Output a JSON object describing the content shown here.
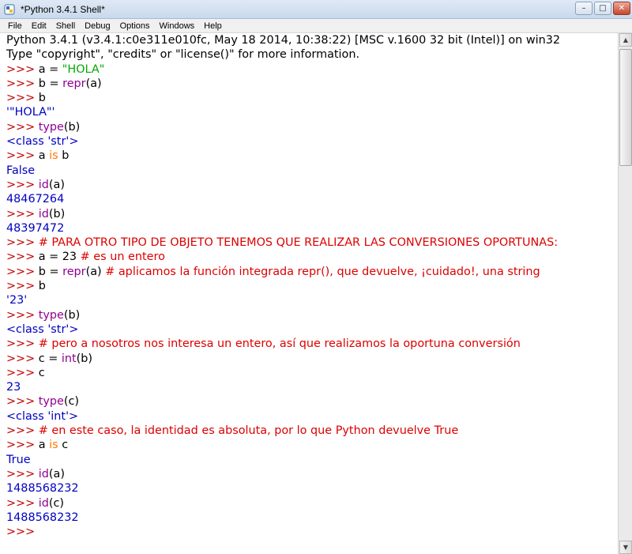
{
  "window": {
    "title": "*Python 3.4.1 Shell*",
    "controls": {
      "minimize": "–",
      "maximize": "□",
      "close": "✕"
    }
  },
  "menu": [
    "File",
    "Edit",
    "Shell",
    "Debug",
    "Options",
    "Windows",
    "Help"
  ],
  "icons": {
    "app": "python-idle-icon",
    "scroll_up": "▲",
    "scroll_down": "▼"
  },
  "colors": {
    "prompt": "#c00000",
    "keyword": "#ff7700",
    "builtin": "#900090",
    "string": "#00aa00",
    "comment": "#dd0000",
    "output": "#0000c0"
  },
  "shell": {
    "lines": [
      [
        [
          "code",
          "Python 3.4.1 (v3.4.1:c0e311e010fc, May 18 2014, 10:38:22) [MSC v.1600 32 bit (Intel)] on win32"
        ]
      ],
      [
        [
          "code",
          "Type \"copyright\", \"credits\" or \"license()\" for more information."
        ]
      ],
      [
        [
          "prompt",
          ">>> "
        ],
        [
          "code",
          "a = "
        ],
        [
          "str",
          "\"HOLA\""
        ]
      ],
      [
        [
          "prompt",
          ">>> "
        ],
        [
          "code",
          "b = "
        ],
        [
          "builtin",
          "repr"
        ],
        [
          "code",
          "(a)"
        ]
      ],
      [
        [
          "prompt",
          ">>> "
        ],
        [
          "code",
          "b"
        ]
      ],
      [
        [
          "output",
          "'\"HOLA\"'"
        ]
      ],
      [
        [
          "prompt",
          ">>> "
        ],
        [
          "builtin",
          "type"
        ],
        [
          "code",
          "(b)"
        ]
      ],
      [
        [
          "output",
          "<class 'str'>"
        ]
      ],
      [
        [
          "prompt",
          ">>> "
        ],
        [
          "code",
          "a "
        ],
        [
          "kw",
          "is"
        ],
        [
          "code",
          " b"
        ]
      ],
      [
        [
          "output",
          "False"
        ]
      ],
      [
        [
          "prompt",
          ">>> "
        ],
        [
          "builtin",
          "id"
        ],
        [
          "code",
          "(a)"
        ]
      ],
      [
        [
          "output",
          "48467264"
        ]
      ],
      [
        [
          "prompt",
          ">>> "
        ],
        [
          "builtin",
          "id"
        ],
        [
          "code",
          "(b)"
        ]
      ],
      [
        [
          "output",
          "48397472"
        ]
      ],
      [
        [
          "prompt",
          ">>> "
        ],
        [
          "comment",
          "# PARA OTRO TIPO DE OBJETO TENEMOS QUE REALIZAR LAS CONVERSIONES OPORTUNAS:"
        ]
      ],
      [
        [
          "prompt",
          ">>> "
        ],
        [
          "code",
          "a = 23 "
        ],
        [
          "comment",
          "# es un entero"
        ]
      ],
      [
        [
          "prompt",
          ">>> "
        ],
        [
          "code",
          "b = "
        ],
        [
          "builtin",
          "repr"
        ],
        [
          "code",
          "(a) "
        ],
        [
          "comment",
          "# aplicamos la función integrada repr(), que devuelve, ¡cuidado!, una string"
        ]
      ],
      [
        [
          "prompt",
          ">>> "
        ],
        [
          "code",
          "b"
        ]
      ],
      [
        [
          "output",
          "'23'"
        ]
      ],
      [
        [
          "prompt",
          ">>> "
        ],
        [
          "builtin",
          "type"
        ],
        [
          "code",
          "(b)"
        ]
      ],
      [
        [
          "output",
          "<class 'str'>"
        ]
      ],
      [
        [
          "prompt",
          ">>> "
        ],
        [
          "comment",
          "# pero a nosotros nos interesa un entero, así que realizamos la oportuna conversión"
        ]
      ],
      [
        [
          "prompt",
          ">>> "
        ],
        [
          "code",
          "c = "
        ],
        [
          "builtin",
          "int"
        ],
        [
          "code",
          "(b)"
        ]
      ],
      [
        [
          "prompt",
          ">>> "
        ],
        [
          "code",
          "c"
        ]
      ],
      [
        [
          "output",
          "23"
        ]
      ],
      [
        [
          "prompt",
          ">>> "
        ],
        [
          "builtin",
          "type"
        ],
        [
          "code",
          "(c)"
        ]
      ],
      [
        [
          "output",
          "<class 'int'>"
        ]
      ],
      [
        [
          "prompt",
          ">>> "
        ],
        [
          "comment",
          "# en este caso, la identidad es absoluta, por lo que Python devuelve True"
        ]
      ],
      [
        [
          "prompt",
          ">>> "
        ],
        [
          "code",
          "a "
        ],
        [
          "kw",
          "is"
        ],
        [
          "code",
          " c"
        ]
      ],
      [
        [
          "output",
          "True"
        ]
      ],
      [
        [
          "prompt",
          ">>> "
        ],
        [
          "builtin",
          "id"
        ],
        [
          "code",
          "(a)"
        ]
      ],
      [
        [
          "output",
          "1488568232"
        ]
      ],
      [
        [
          "prompt",
          ">>> "
        ],
        [
          "builtin",
          "id"
        ],
        [
          "code",
          "(c)"
        ]
      ],
      [
        [
          "output",
          "1488568232"
        ]
      ],
      [
        [
          "prompt",
          ">>> "
        ]
      ]
    ]
  }
}
